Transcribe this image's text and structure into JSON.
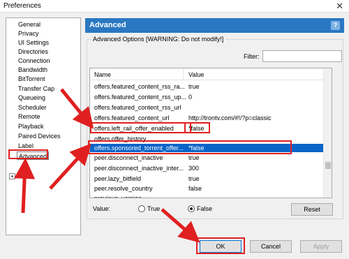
{
  "window": {
    "title": "Preferences",
    "close_glyph": "✕"
  },
  "sidebar": {
    "items": [
      {
        "label": "General"
      },
      {
        "label": "Privacy"
      },
      {
        "label": "UI Settings"
      },
      {
        "label": "Directories"
      },
      {
        "label": "Connection"
      },
      {
        "label": "Bandwidth"
      },
      {
        "label": "BitTorrent"
      },
      {
        "label": "Transfer Cap"
      },
      {
        "label": "Queueing"
      },
      {
        "label": "Scheduler"
      },
      {
        "label": "Remote"
      },
      {
        "label": "Playback"
      },
      {
        "label": "Paired Devices"
      },
      {
        "label": "Label"
      },
      {
        "label": "Advanced"
      }
    ],
    "expand_glyph": "+",
    "selected": "Advanced"
  },
  "header": {
    "title": "Advanced",
    "help_glyph": "?"
  },
  "group": {
    "legend": "Advanced Options [WARNING: Do not modify!]"
  },
  "filter": {
    "label": "Filter:",
    "value": ""
  },
  "table": {
    "columns": {
      "name": "Name",
      "value": "Value"
    },
    "rows": [
      {
        "name": "offers.featured_content_rss_ra...",
        "value": "true"
      },
      {
        "name": "offers.featured_content_rss_up...",
        "value": "0"
      },
      {
        "name": "offers.featured_content_rss_url",
        "value": ""
      },
      {
        "name": "offers.featured_content_url",
        "value": "http://trontv.com/#!/?p=classic"
      },
      {
        "name": "offers.left_rail_offer_enabled",
        "value": "*false"
      },
      {
        "name": "offers.offer_history",
        "value": ""
      },
      {
        "name": "offers.sponsored_torrent_offer...",
        "value": "*false"
      },
      {
        "name": "peer.disconnect_inactive",
        "value": "true"
      },
      {
        "name": "peer.disconnect_inactive_inter...",
        "value": "300"
      },
      {
        "name": "peer.lazy_bitfield",
        "value": "true"
      },
      {
        "name": "peer.resolve_country",
        "value": "false"
      },
      {
        "name": "previous_version",
        "value": ""
      }
    ],
    "selected_row": "offers.sponsored_torrent_offer..."
  },
  "value_editor": {
    "label": "Value:",
    "options": [
      {
        "label": "True"
      },
      {
        "label": "False"
      }
    ],
    "selected": "False",
    "reset_label": "Reset"
  },
  "footer": {
    "ok_label": "OK",
    "cancel_label": "Cancel",
    "apply_label": "Apply"
  },
  "colors": {
    "header_bg": "#2a78c2",
    "selection": "#0a64c8",
    "annotation": "#e02020"
  }
}
